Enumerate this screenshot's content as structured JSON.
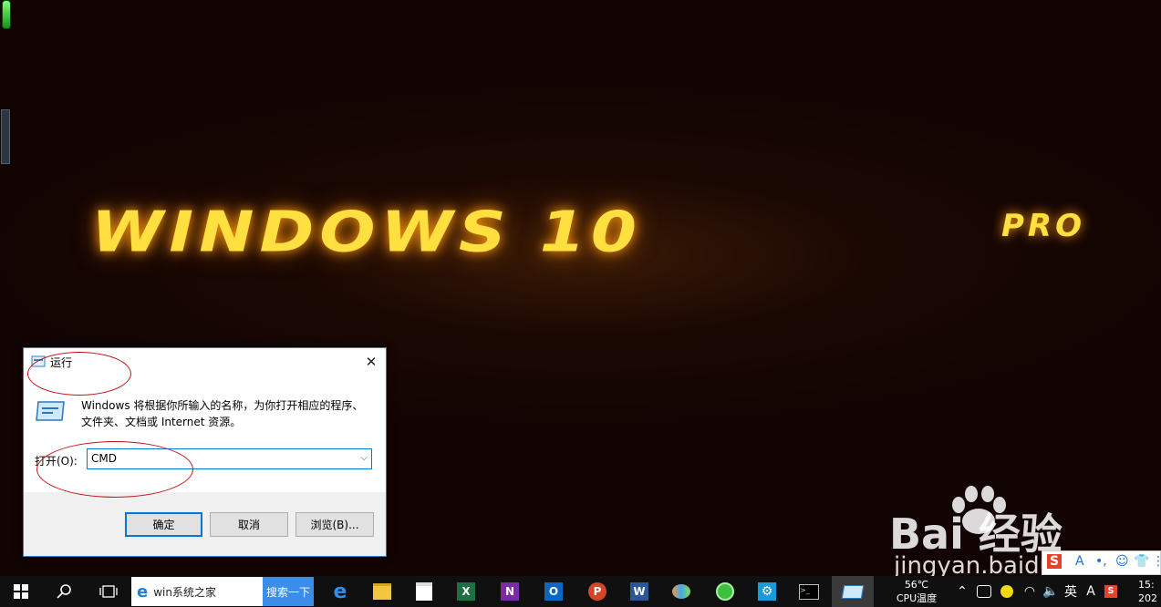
{
  "wallpaper": {
    "title": "WINDOWS 10",
    "edition": "PRO"
  },
  "run_dialog": {
    "title": "运行",
    "close_glyph": "✕",
    "description": "Windows 将根据你所输入的名称，为你打开相应的程序、文件夹、文档或 Internet 资源。",
    "open_label": "打开(O):",
    "input_value": "CMD",
    "ok_label": "确定",
    "cancel_label": "取消",
    "browse_label": "浏览(B)..."
  },
  "watermark": {
    "brand": "Bai  经验",
    "url": "jingyan.baidu.com"
  },
  "ime": {
    "items": [
      "S",
      "A",
      "•,",
      "☺",
      "👕",
      "⋮"
    ]
  },
  "taskbar": {
    "search_text": "win系统之家",
    "search_button": "搜索一下",
    "apps": [
      "edge-icon",
      "file-explorer-icon",
      "store-icon",
      "excel-icon",
      "onenote-icon",
      "outlook-icon",
      "powerpoint-icon",
      "word-icon",
      "paint-icon",
      "360-icon",
      "settings-icon",
      "terminal-icon",
      "run-icon"
    ],
    "cpu_temp": "56℃",
    "cpu_label": "CPU温度",
    "clock_time": "15:",
    "clock_date": "202"
  }
}
